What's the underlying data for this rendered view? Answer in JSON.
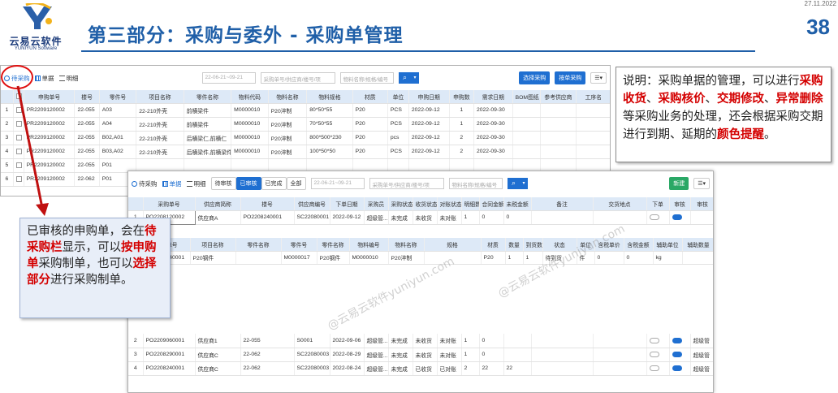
{
  "header": {
    "date": "27.11.2022",
    "logo_cn": "云易云软件",
    "logo_en": "YUNIYUN Software",
    "title": "第三部分：采购与委外 - 采购单管理",
    "page_number": "38"
  },
  "colors": {
    "brand_blue": "#1f5fa8",
    "accent": "#1f6fd1",
    "highlight_red": "#d40000"
  },
  "watermark": "@云易云软件yuniyun.com",
  "screen1": {
    "tabs": [
      {
        "label": "待采购",
        "icon": "circle-icon"
      },
      {
        "label": "单据",
        "icon": "grid-icon"
      },
      {
        "label": "明细",
        "icon": "list-icon"
      }
    ],
    "date_range": "22-06-21~09-21",
    "search_placeholder_1": "采购单号/供应商/楼号/项",
    "search_placeholder_2": "物料名称/规格/编号",
    "buttons": [
      "选择采购",
      "按单采购"
    ],
    "columns": [
      "",
      "",
      "申购单号",
      "楼号",
      "零件号",
      "项目名称",
      "零件名称",
      "物料代码",
      "物料名称",
      "物料规格",
      "材质",
      "单位",
      "申购日期",
      "申购数",
      "需求日期",
      "BOM图纸",
      "参考供应商",
      "工序名"
    ],
    "rows": [
      {
        "no": "1",
        "req_no": "PR2209120002",
        "building": "22-055",
        "part_no": "A03",
        "project": "22-210外壳",
        "part_name": "前横梁件",
        "code": "M0000010",
        "material": "P20淬制",
        "spec": "80*50*55",
        "texture": "P20",
        "unit": "PCS",
        "req_date": "2022-09-12",
        "qty": "1",
        "need_date": "2022-09-30"
      },
      {
        "no": "2",
        "req_no": "PR2209120002",
        "building": "22-055",
        "part_no": "A04",
        "project": "22-210外壳",
        "part_name": "前横梁件",
        "code": "M0000010",
        "material": "P20淬制",
        "spec": "70*50*55",
        "texture": "P20",
        "unit": "PCS",
        "req_date": "2022-09-12",
        "qty": "1",
        "need_date": "2022-09-30"
      },
      {
        "no": "3",
        "req_no": "PR2209120002",
        "building": "22-055",
        "part_no": "B02,A01",
        "project": "22-210外壳",
        "part_name": "后横梁仁,前横仁",
        "code": "M0000010",
        "material": "P20淬制",
        "spec": "800*500*230",
        "texture": "P20",
        "unit": "pcs",
        "req_date": "2022-09-12",
        "qty": "2",
        "need_date": "2022-09-30"
      },
      {
        "no": "4",
        "req_no": "PR2209120002",
        "building": "22-055",
        "part_no": "B03,A02",
        "project": "22-210外壳",
        "part_name": "后横梁件,前横梁件",
        "code": "M0000010",
        "material": "P20淬制",
        "spec": "100*50*50",
        "texture": "P20",
        "unit": "PCS",
        "req_date": "2022-09-12",
        "qty": "2",
        "need_date": "2022-09-30"
      },
      {
        "no": "5",
        "req_no": "PR2209120002",
        "building": "22-055",
        "part_no": "P01",
        "project": "",
        "part_name": "",
        "code": "",
        "material": "",
        "spec": "",
        "texture": "",
        "unit": "",
        "req_date": "",
        "qty": "",
        "need_date": ""
      },
      {
        "no": "6",
        "req_no": "PR2209120002",
        "building": "22-062",
        "part_no": "P01",
        "project": "",
        "part_name": "",
        "code": "",
        "material": "",
        "spec": "",
        "texture": "",
        "unit": "",
        "req_date": "",
        "qty": "",
        "need_date": ""
      }
    ]
  },
  "screen2": {
    "tabs": [
      {
        "label": "待采购",
        "icon": "circle-icon"
      },
      {
        "label": "单据",
        "icon": "grid-icon"
      },
      {
        "label": "明细",
        "icon": "list-icon"
      }
    ],
    "filters": [
      "待审核",
      "已审核",
      "已完成",
      "全部"
    ],
    "active_filter": "已审核",
    "date_range": "22-06-21~09-21",
    "search_placeholder_1": "采购单号/供应商/楼号/项",
    "search_placeholder_2": "物料名称/规格/编号",
    "new_button": "新建",
    "columns": [
      "",
      "采购单号",
      "供应商简称",
      "楼号",
      "供应商编号",
      "下单日期",
      "采购员",
      "采购状态",
      "收货状态",
      "对账状态",
      "明细数",
      "合同金额",
      "未税金额",
      "备注",
      "交货地点",
      "下单",
      "审核",
      "审核"
    ],
    "row1": {
      "po_no": "PO2208120002",
      "supplier": "供应商A",
      "building": "PO2208240001",
      "supplier_no": "SC22080001",
      "order_date": "2022-09-12",
      "buyer": "超级管...",
      "po_status": "未完成",
      "recv": "未收货",
      "recon": "未对账",
      "count": "1",
      "amount": "0",
      "untaxed": "0"
    },
    "sub_columns": [
      "采购单号",
      "项目名称",
      "零件名称",
      "零件号",
      "零件名称",
      "物料编号",
      "物料名称",
      "规格",
      "材质",
      "数量",
      "到货数",
      "状态",
      "单位",
      "含税单价",
      "含税金额",
      "辅助单位",
      "辅助数量"
    ],
    "sub_row": {
      "po_no": "PO2208240001",
      "project": "P20钢件",
      "part_no": "M0000017",
      "part_name": "P20钢件",
      "code": "M0000010",
      "material": "P20淬制",
      "texture": "P20",
      "qty": "1",
      "arrived": "1",
      "status": "待到货",
      "unit": "件",
      "price": "0",
      "amount": "0",
      "aux_unit": "kg"
    },
    "rows": [
      {
        "no": "2",
        "po_no": "PO2209060001",
        "supplier": "供应商1",
        "building": "22-055",
        "supplier_no": "S0001",
        "order_date": "2022-09-06",
        "buyer": "超级管...",
        "po_status": "未完成",
        "recv": "未收货",
        "recon": "未对账",
        "count": "1",
        "amount": "0",
        "untaxed": "",
        "approve": "超级管"
      },
      {
        "no": "3",
        "po_no": "PO2208290001",
        "supplier": "供应商C",
        "building": "22-062",
        "supplier_no": "SC22080003",
        "order_date": "2022-08-29",
        "buyer": "超级管...",
        "po_status": "未完成",
        "recv": "未收货",
        "recon": "未对账",
        "count": "1",
        "amount": "0",
        "untaxed": "",
        "approve": "超级管"
      },
      {
        "no": "4",
        "po_no": "PO2208240001",
        "supplier": "供应商C",
        "building": "22-062",
        "supplier_no": "SC22080003",
        "order_date": "2022-08-24",
        "buyer": "超级管...",
        "po_status": "未完成",
        "recv": "已收货",
        "recon": "已对账",
        "count": "2",
        "amount": "22",
        "untaxed": "22",
        "approve": "超级管"
      }
    ]
  },
  "note_right": {
    "p1": "说明：采购单据的管理，可以进行",
    "h1": "采购收货",
    "s1": "、",
    "h2": "采购核价",
    "s2": "、",
    "h3": "交期修改",
    "s3": "、",
    "h4": "异常删除",
    "p2": "等采购业务的处理，还会根据采购交期进行到期、延期的",
    "h5": "颜色提醒",
    "p3": "。"
  },
  "note_left": {
    "p1": "已审核的申购单，会在",
    "h1": "待采购栏",
    "p2": "显示，可以",
    "h2": "按申购单",
    "p3": "采购制单，也可以",
    "h3": "选择部分",
    "p4": "进行采购制单。"
  }
}
